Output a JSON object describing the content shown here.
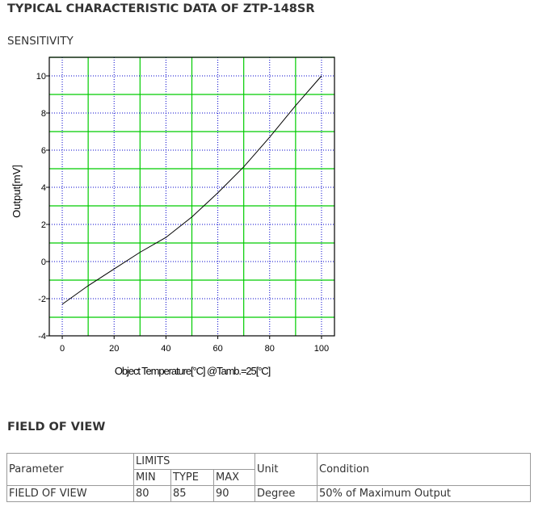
{
  "page": {
    "title": "TYPICAL CHARACTERISTIC DATA OF ZTP-148SR",
    "sensitivity_heading": "SENSITIVITY",
    "fov_heading": "FIELD OF VIEW"
  },
  "chart_data": {
    "type": "line",
    "title": "",
    "xlabel": "Object Temperature[°C] @Tamb.=25[°C]",
    "ylabel": "Output[mV]",
    "xlim": [
      -5,
      105
    ],
    "ylim": [
      -4,
      11
    ],
    "x_ticks": [
      0,
      20,
      40,
      60,
      80,
      100
    ],
    "y_ticks": [
      -4,
      -2,
      0,
      2,
      4,
      6,
      8,
      10
    ],
    "grid": true,
    "grid_major_color": "#00cc00",
    "grid_minor_color": "#0000cc",
    "line_color": "#000000",
    "series": [
      {
        "x": [
          0,
          10,
          20,
          30,
          40,
          50,
          60,
          70,
          80,
          90,
          100
        ],
        "values": [
          -2.3,
          -1.3,
          -0.4,
          0.5,
          1.3,
          2.4,
          3.7,
          5.1,
          6.7,
          8.4,
          10.0
        ]
      }
    ]
  },
  "fov_table": {
    "parameter_header": "Parameter",
    "limits_header": "LIMITS",
    "min_header": "MIN",
    "type_header": "TYPE",
    "max_header": "MAX",
    "unit_header": "Unit",
    "condition_header": "Condition",
    "row": {
      "parameter": "FIELD OF VIEW",
      "min": "80",
      "type": "85",
      "max": "90",
      "unit": "Degree",
      "condition": "50% of Maximum Output"
    }
  }
}
